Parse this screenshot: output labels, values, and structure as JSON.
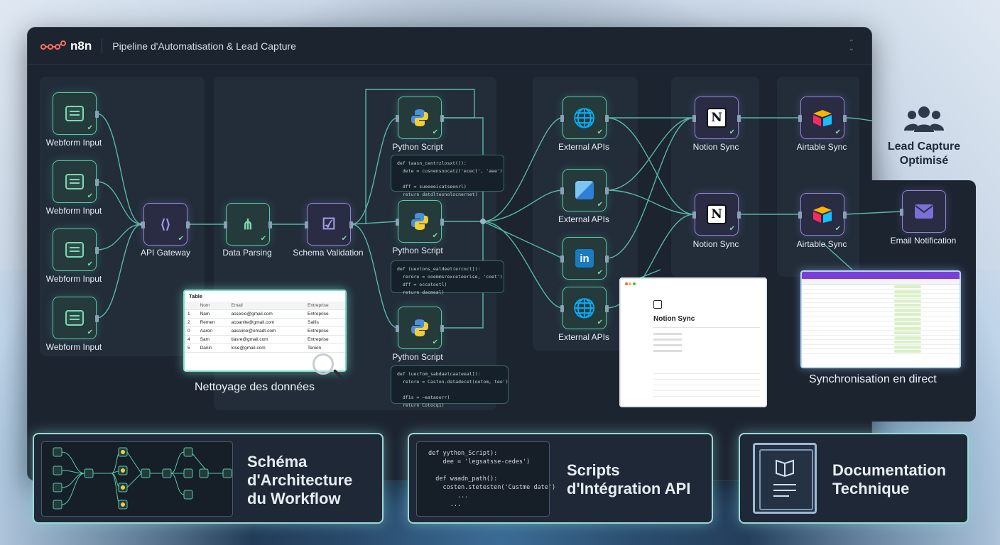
{
  "header": {
    "logo_text": "n8n",
    "title": "Pipeline d'Automatisation & Lead Capture"
  },
  "nodes": {
    "webform_1": "Webform Input",
    "webform_2": "Webform Input",
    "webform_3": "Webform Input",
    "webform_4": "Webform Input",
    "api_gateway": "API Gateway",
    "data_parsing": "Data Parsing",
    "schema_validation": "Schema Validation",
    "python_1": "Python Script",
    "python_2": "Python Script",
    "python_3": "Python Script",
    "external_1": "External APIs",
    "external_2": "External APIs",
    "external_3": "External APIs",
    "notion_1": "Notion Sync",
    "notion_2": "Notion Sync",
    "airtable_1": "Airtable Sync",
    "airtable_2": "Airtable Sync",
    "email": "Email Notification"
  },
  "code_snippets": {
    "python_1": "def taasn_centrzlosxt()):\n  dete = cusnensoocatz('ecect', 'aee')\n\n  dff = sueeeeicatseonrl)\n  return datdltesnolocnernet)",
    "python_2": "def (uevtons_ealdeet(ercoct]):\n  rerere = ooemmsrexceteerise, 'coet')\n  dff = occatootl)\n  return dacmeal)",
    "python_3": "def tuecfom_sabdaelcaateeal]):\n  retore = Caston.datadecet(ootom, teo')\n\n  df1s = —eataoorr)\n  return Cotocq1)"
  },
  "table": {
    "title": "Table",
    "headers": [
      "Nom",
      "Email",
      "Entreprise"
    ],
    "rows": [
      [
        "1",
        "Nam",
        "acsecio@gmail.com",
        "Entreprise"
      ],
      [
        "2",
        "Remen",
        "acoanite@gmail.com",
        "Saifis"
      ],
      [
        "0",
        "Aaron",
        "aassiine@omadt-com",
        "Entreprise"
      ],
      [
        "4",
        "Sam",
        "tiasre@gmail.com",
        "Entreprise"
      ],
      [
        "5",
        "Danin",
        "lose@gmail.com",
        "Tenion"
      ]
    ]
  },
  "captions": {
    "cleaning": "Nettoyage des données",
    "sync_live": "Synchronisation en direct",
    "lead_line1": "Lead Capture",
    "lead_line2": "Optimisé"
  },
  "notion_preview": {
    "title": "Notion Sync"
  },
  "cards": [
    {
      "title_line1": "Schéma",
      "title_line2": "d'Architecture",
      "title_line3": "du Workflow"
    },
    {
      "title_line1": "Scripts",
      "title_line2": "d'Intégration API",
      "code": "def yython_Script):\n    dee = 'legsatsse-cedes')\n\n  def waadn_path():\n    costen.stetesten('Custme date')\n        ...\n      ..."
    },
    {
      "title_line1": "Documentation",
      "title_line2": "Technique"
    }
  ],
  "colors": {
    "accent": "#58c9a8",
    "violet": "#8f86d8",
    "card_glow": "#9ad8d6"
  },
  "icons": [
    "form-icon",
    "gateway-icon",
    "parsing-icon",
    "validation-icon",
    "python-icon",
    "globe-icon",
    "linkedin-icon",
    "notion-icon",
    "airtable-icon",
    "email-icon",
    "people-icon",
    "book-icon",
    "magnifier-icon"
  ]
}
